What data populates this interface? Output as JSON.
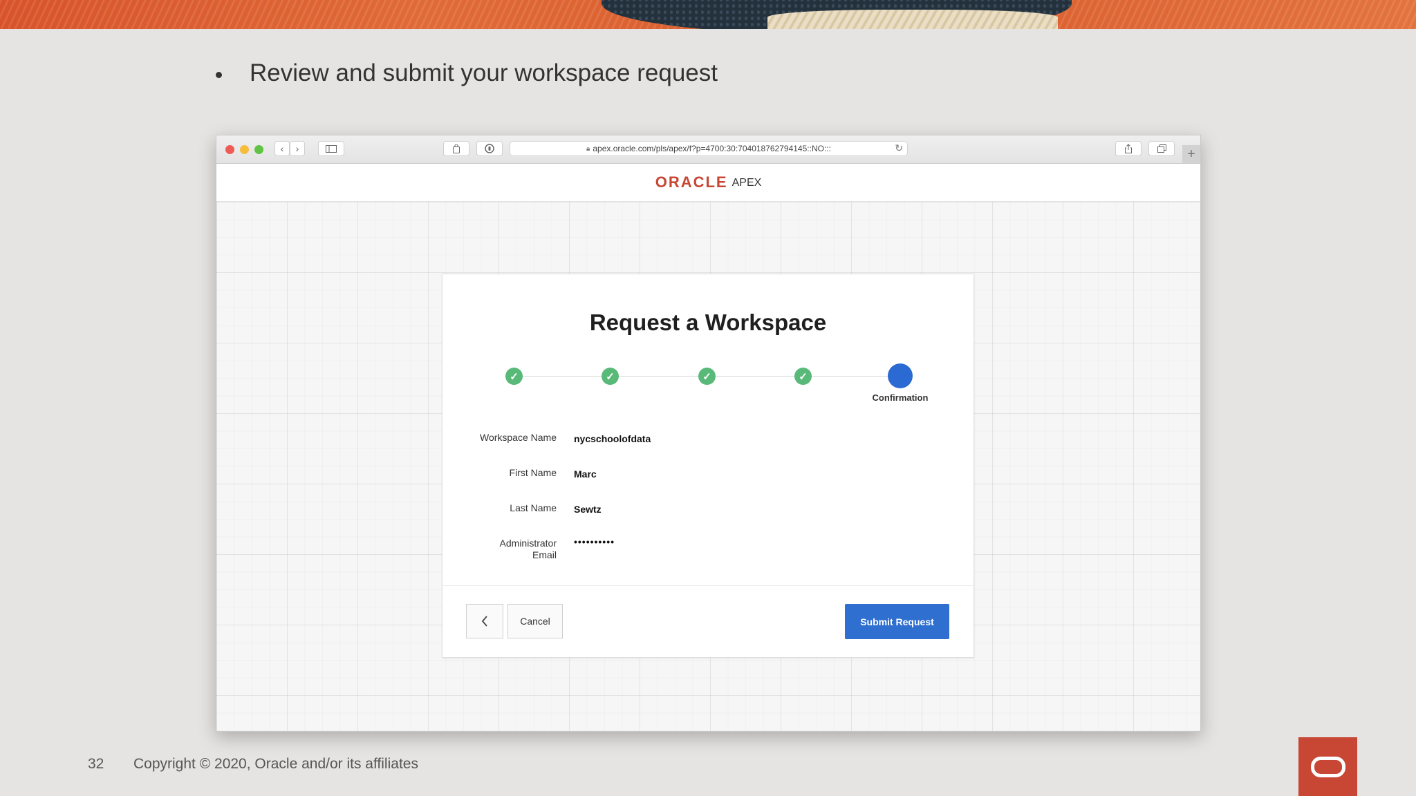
{
  "slide": {
    "bullet_text": "Review and submit your workspace request",
    "page_number": "32",
    "copyright": "Copyright © 2020, Oracle and/or its affiliates"
  },
  "browser": {
    "url": "apex.oracle.com/pls/apex/f?p=4700:30:704018762794145::NO:::",
    "icons": [
      "back-icon",
      "forward-icon",
      "sidebar-icon",
      "reader-icon",
      "privacy-icon",
      "lock-icon",
      "reload-icon",
      "share-icon",
      "tabs-icon",
      "new-tab-icon"
    ]
  },
  "app_header": {
    "logo_text": "ORACLE",
    "product_text": "APEX",
    "brand_color": "#c74634"
  },
  "dialog": {
    "title": "Request a Workspace",
    "steps": [
      {
        "state": "complete"
      },
      {
        "state": "complete"
      },
      {
        "state": "complete"
      },
      {
        "state": "complete"
      },
      {
        "state": "current",
        "label": "Confirmation"
      }
    ],
    "step_complete_color": "#58b978",
    "step_current_color": "#2c6ad3",
    "fields": [
      {
        "label": "Workspace Name",
        "value": "nycschoolofdata"
      },
      {
        "label": "First Name",
        "value": "Marc"
      },
      {
        "label": "Last Name",
        "value": "Sewtz"
      },
      {
        "label_line1": "Administrator",
        "label_line2": "Email",
        "value": "••••••••••"
      }
    ],
    "buttons": {
      "back_icon": "chevron-left-icon",
      "cancel_label": "Cancel",
      "submit_label": "Submit Request"
    }
  }
}
